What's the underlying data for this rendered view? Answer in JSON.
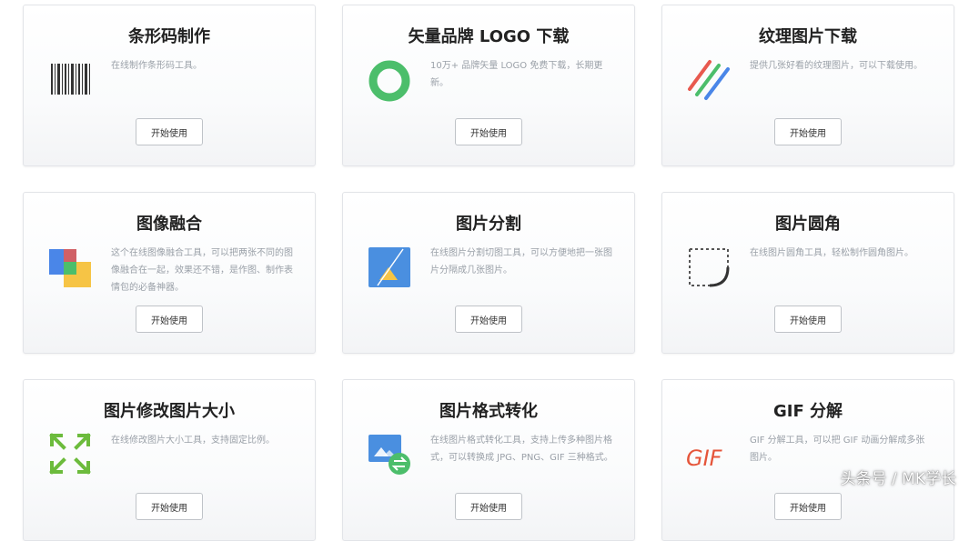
{
  "tools": [
    {
      "title": "条形码制作",
      "desc": "在线制作条形码工具。",
      "button": "开始使用",
      "icon": "barcode-icon"
    },
    {
      "title": "矢量品牌 LOGO 下载",
      "desc": "10万+ 品牌矢量 LOGO 免费下载，长期更新。",
      "button": "开始使用",
      "icon": "ring-logo-icon"
    },
    {
      "title": "纹理图片下载",
      "desc": "提供几张好看的纹理图片，可以下载使用。",
      "button": "开始使用",
      "icon": "stripes-texture-icon"
    },
    {
      "title": "图像融合",
      "desc": "这个在线图像融合工具，可以把两张不同的图像融合在一起，效果还不错，是作图、制作表情包的必备神器。",
      "button": "开始使用",
      "icon": "image-blend-icon"
    },
    {
      "title": "图片分割",
      "desc": "在线图片分割切图工具，可以方便地把一张图片分隔成几张图片。",
      "button": "开始使用",
      "icon": "image-split-icon"
    },
    {
      "title": "图片圆角",
      "desc": "在线图片圆角工具，轻松制作圆角图片。",
      "button": "开始使用",
      "icon": "rounded-corner-icon"
    },
    {
      "title": "图片修改图片大小",
      "desc": "在线修改图片大小工具，支持固定比例。",
      "button": "开始使用",
      "icon": "resize-arrows-icon"
    },
    {
      "title": "图片格式转化",
      "desc": "在线图片格式转化工具，支持上传多种图片格式，可以转换成 JPG、PNG、GIF 三种格式。",
      "button": "开始使用",
      "icon": "format-convert-icon"
    },
    {
      "title": "GIF 分解",
      "desc": "GIF 分解工具，可以把 GIF 动画分解成多张图片。",
      "button": "开始使用",
      "icon": "gif-icon",
      "icon_text": "GIF"
    }
  ],
  "watermark": "头条号 / MK学长",
  "colors": {
    "ring_green": "#4cbe6b",
    "blend_blue": "#4a86e8",
    "blend_red": "#e8594f",
    "blend_yellow": "#f6c445",
    "split_blue": "#4a8fe0",
    "resize_green": "#6cbb3c",
    "gif_red": "#e5553a"
  }
}
